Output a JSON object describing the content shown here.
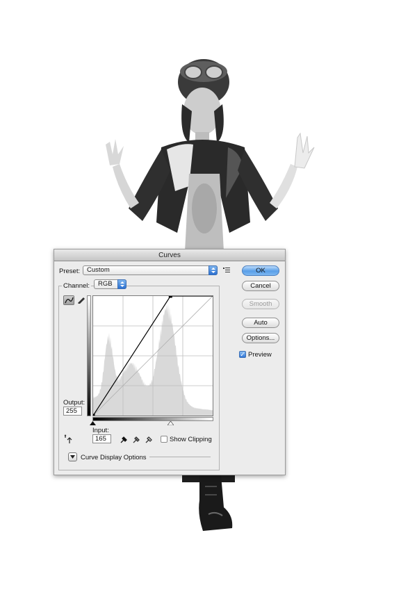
{
  "dialog": {
    "title": "Curves",
    "preset": {
      "label": "Preset:",
      "value": "Custom"
    },
    "channel": {
      "label": "Channel:",
      "value": "RGB"
    },
    "buttons": {
      "ok": "OK",
      "cancel": "Cancel",
      "smooth": "Smooth",
      "auto": "Auto",
      "options": "Options..."
    },
    "preview": {
      "label": "Preview",
      "checked": true
    },
    "output": {
      "label": "Output:",
      "value": "255"
    },
    "input": {
      "label": "Input:",
      "value": "165"
    },
    "show_clipping": {
      "label": "Show Clipping",
      "checked": false
    },
    "curve_display_options": {
      "label": "Curve Display Options"
    },
    "curve_points": [
      {
        "in": 0,
        "out": 0
      },
      {
        "in": 165,
        "out": 255
      }
    ],
    "colors": {
      "accent": "#3a82df",
      "histogram": "#d9d9d9"
    },
    "icons": [
      "preset-menu-icon",
      "curve-tool-icon",
      "pencil-tool-icon",
      "black-eyedropper-icon",
      "gray-eyedropper-icon",
      "white-eyedropper-icon",
      "on-image-adjust-icon",
      "disclosure-icon"
    ]
  }
}
